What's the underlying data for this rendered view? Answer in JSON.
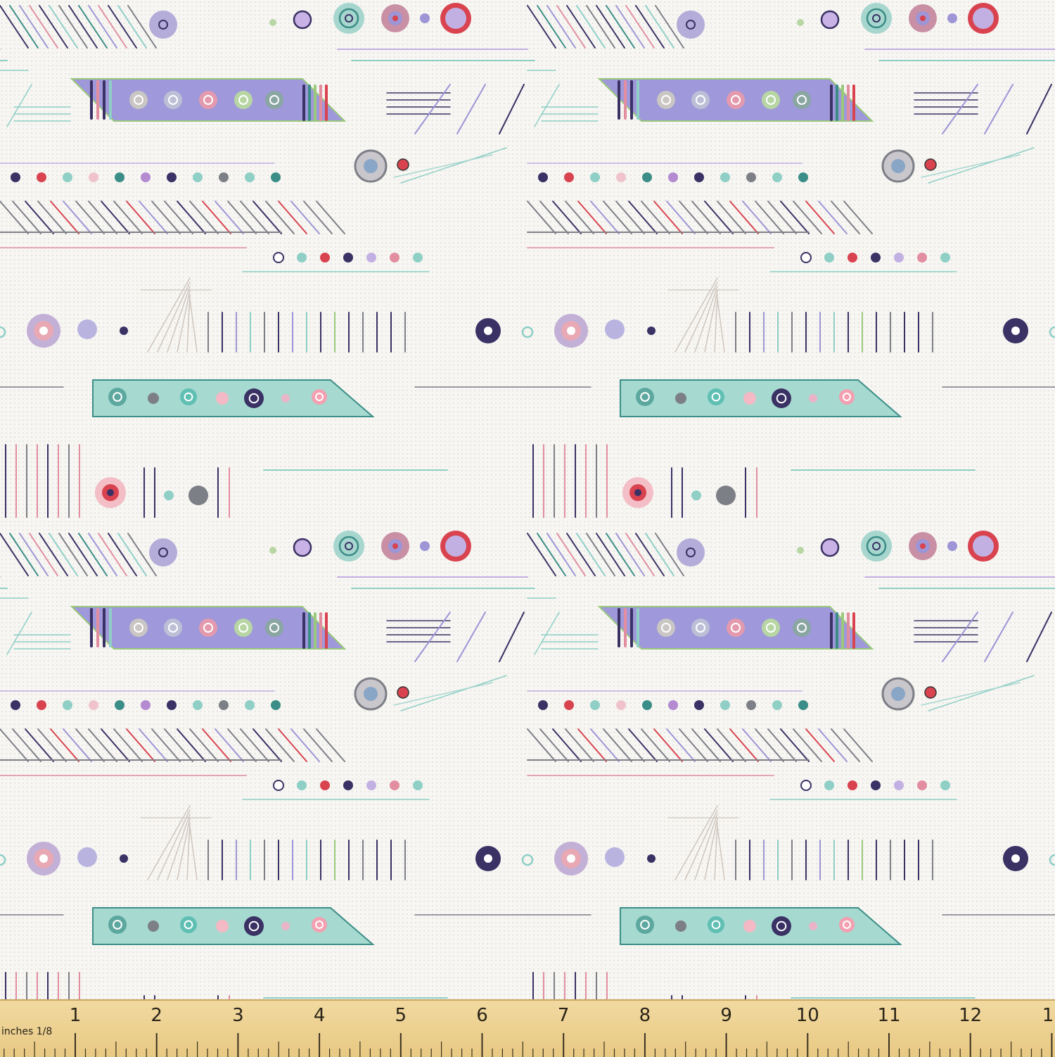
{
  "colors": {
    "background": "#f7f6f3",
    "lavender": "#9d95d6",
    "teal": "#8fcfc6",
    "teal_dark": "#3b8e87",
    "navy": "#3a3164",
    "rose": "#e38ea0",
    "coral": "#d9434f",
    "grey": "#7d7f86",
    "green": "#9ac97c",
    "ruler_wood": "#ecd08f"
  },
  "ruler": {
    "unit_caption": "inches 1/8",
    "labels": [
      "1",
      "2",
      "3",
      "4",
      "5",
      "6",
      "7",
      "8",
      "9",
      "10",
      "11",
      "12",
      "1"
    ]
  }
}
